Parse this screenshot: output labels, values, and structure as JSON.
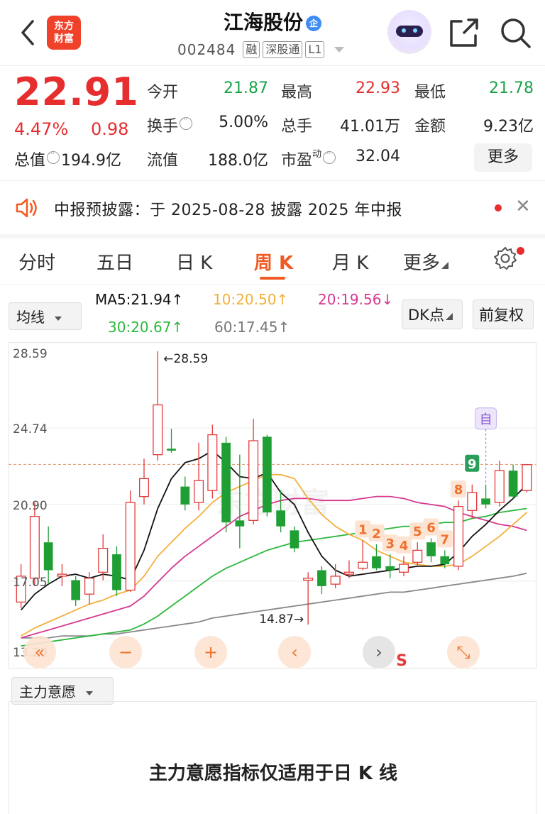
{
  "header": {
    "title": "江海股份",
    "title_badge": "企",
    "code": "002484",
    "tags": [
      "融",
      "深股通",
      "L1"
    ],
    "logo_line1": "东方",
    "logo_line2": "财富"
  },
  "quote": {
    "price": "22.91",
    "change_pct": "4.47%",
    "change": "0.98",
    "total_value_label": "总值",
    "total_value": "194.9亿",
    "fields": [
      {
        "label": "今开",
        "value": "21.87",
        "color": "green"
      },
      {
        "label": "最高",
        "value": "22.93",
        "color": "red"
      },
      {
        "label": "最低",
        "value": "21.78",
        "color": "green"
      },
      {
        "label": "换手",
        "value": "5.00%",
        "color": "black",
        "info": true
      },
      {
        "label": "总手",
        "value": "41.01万",
        "color": "black"
      },
      {
        "label": "金额",
        "value": "9.23亿",
        "color": "black"
      },
      {
        "label": "流值",
        "value": "188.0亿",
        "color": "black"
      },
      {
        "label": "市盈",
        "label_sup": "动",
        "value": "32.04",
        "color": "black",
        "info": true
      }
    ],
    "more_label": "更多"
  },
  "notice": {
    "text": "中报预披露：于 2025-08-28 披露 2025 年中报"
  },
  "tabs": [
    "分时",
    "五日",
    "日 K",
    "周 K",
    "月 K",
    "更多"
  ],
  "active_tab": "周 K",
  "indicator": {
    "select_label": "均线",
    "ma5": "MA5:21.94",
    "ma10": "10:20.50",
    "ma20": "20:19.56",
    "ma30": "30:20.67",
    "ma60": "60:17.45",
    "dk_label": "DK点",
    "fq_label": "前复权",
    "colors": {
      "ma5": "#111111",
      "ma10": "#f2b03c",
      "ma20": "#d6388f",
      "ma30": "#2db83d",
      "ma60": "#888888"
    }
  },
  "chart_data": {
    "type": "candlestick",
    "y_ticks": [
      "28.59",
      "24.74",
      "20.90",
      "17.05",
      "13.20"
    ],
    "ylim": [
      13.2,
      28.59
    ],
    "max_label": "←28.59",
    "min_label": "14.87→",
    "last_close": 22.91,
    "watermark": "东方财富",
    "candles": [
      {
        "o": 16.0,
        "c": 17.3,
        "h": 17.9,
        "l": 15.7
      },
      {
        "o": 17.2,
        "c": 20.3,
        "h": 21.0,
        "l": 16.8
      },
      {
        "o": 19.0,
        "c": 17.6,
        "h": 19.8,
        "l": 16.9
      },
      {
        "o": 17.3,
        "c": 17.4,
        "h": 17.9,
        "l": 16.8
      },
      {
        "o": 17.1,
        "c": 16.1,
        "h": 17.3,
        "l": 15.8
      },
      {
        "o": 16.4,
        "c": 17.2,
        "h": 17.5,
        "l": 15.9
      },
      {
        "o": 17.5,
        "c": 18.7,
        "h": 19.4,
        "l": 17.1
      },
      {
        "o": 18.4,
        "c": 16.6,
        "h": 18.8,
        "l": 16.3
      },
      {
        "o": 16.6,
        "c": 21.0,
        "h": 21.6,
        "l": 16.5
      },
      {
        "o": 21.3,
        "c": 22.2,
        "h": 23.2,
        "l": 20.9
      },
      {
        "o": 23.4,
        "c": 25.9,
        "h": 28.59,
        "l": 23.1
      },
      {
        "o": 23.7,
        "c": 23.6,
        "h": 24.7,
        "l": 23.5
      },
      {
        "o": 21.8,
        "c": 20.9,
        "h": 22.3,
        "l": 20.6
      },
      {
        "o": 21.0,
        "c": 22.1,
        "h": 24.0,
        "l": 20.6
      },
      {
        "o": 21.6,
        "c": 24.4,
        "h": 24.9,
        "l": 21.2
      },
      {
        "o": 24.0,
        "c": 20.0,
        "h": 24.3,
        "l": 19.5
      },
      {
        "o": 20.1,
        "c": 19.8,
        "h": 23.4,
        "l": 18.7
      },
      {
        "o": 20.1,
        "c": 24.1,
        "h": 25.2,
        "l": 19.9
      },
      {
        "o": 24.3,
        "c": 20.5,
        "h": 24.4,
        "l": 20.3
      },
      {
        "o": 20.6,
        "c": 19.8,
        "h": 21.6,
        "l": 19.5
      },
      {
        "o": 19.6,
        "c": 18.7,
        "h": 19.8,
        "l": 18.5
      },
      {
        "o": 17.1,
        "c": 17.2,
        "h": 17.5,
        "l": 14.87
      },
      {
        "o": 17.6,
        "c": 16.8,
        "h": 17.8,
        "l": 16.4
      },
      {
        "o": 16.9,
        "c": 17.3,
        "h": 17.9,
        "l": 16.7
      },
      {
        "o": 17.4,
        "c": 17.5,
        "h": 18.1,
        "l": 17.2
      },
      {
        "o": 17.7,
        "c": 18.0,
        "h": 19.1,
        "l": 17.6
      },
      {
        "o": 18.3,
        "c": 17.7,
        "h": 18.9,
        "l": 17.6
      },
      {
        "o": 17.8,
        "c": 17.6,
        "h": 18.4,
        "l": 17.2
      },
      {
        "o": 17.5,
        "c": 17.9,
        "h": 18.3,
        "l": 17.3
      },
      {
        "o": 18.0,
        "c": 18.6,
        "h": 19.0,
        "l": 17.8
      },
      {
        "o": 19.0,
        "c": 18.3,
        "h": 19.2,
        "l": 18.0
      },
      {
        "o": 18.3,
        "c": 17.9,
        "h": 18.6,
        "l": 17.7
      },
      {
        "o": 17.8,
        "c": 20.8,
        "h": 21.1,
        "l": 17.6
      },
      {
        "o": 20.6,
        "c": 21.5,
        "h": 21.9,
        "l": 20.2
      },
      {
        "o": 21.2,
        "c": 20.9,
        "h": 21.9,
        "l": 20.7
      },
      {
        "o": 21.0,
        "c": 22.6,
        "h": 23.1,
        "l": 20.8
      },
      {
        "o": 22.6,
        "c": 21.3,
        "h": 22.9,
        "l": 21.2
      },
      {
        "o": 21.6,
        "c": 22.9,
        "h": 22.93,
        "l": 21.5
      }
    ],
    "ma5_line": [
      15.6,
      16.4,
      16.9,
      17.3,
      17.4,
      17.2,
      17.4,
      17.3,
      17.1,
      18.6,
      20.7,
      22.2,
      23.0,
      23.2,
      23.6,
      23.0,
      22.3,
      22.2,
      22.5,
      21.5,
      20.9,
      19.5,
      18.3,
      17.6,
      17.3,
      17.4,
      17.5,
      17.6,
      17.7,
      17.8,
      17.8,
      17.9,
      18.5,
      19.3,
      19.9,
      20.6,
      21.2,
      21.9
    ],
    "ma10_line": [
      14.3,
      14.7,
      15.0,
      15.3,
      15.6,
      15.9,
      16.1,
      16.4,
      16.6,
      17.3,
      18.3,
      19.0,
      19.7,
      20.3,
      21.0,
      21.5,
      21.8,
      22.1,
      22.4,
      22.4,
      22.2,
      21.2,
      20.4,
      19.8,
      19.4,
      19.1,
      18.6,
      18.3,
      18.0,
      17.9,
      17.8,
      17.8,
      17.9,
      18.3,
      18.8,
      19.3,
      19.9,
      20.5
    ],
    "ma20_line": [
      14.2,
      14.4,
      14.6,
      14.8,
      15.0,
      15.2,
      15.4,
      15.6,
      15.8,
      16.3,
      17.0,
      17.7,
      18.3,
      18.8,
      19.3,
      19.8,
      20.3,
      20.6,
      20.9,
      21.1,
      21.2,
      21.2,
      21.1,
      21.1,
      21.1,
      21.2,
      21.3,
      21.3,
      21.2,
      21.0,
      20.9,
      20.8,
      20.5,
      20.3,
      20.1,
      19.9,
      19.8,
      19.6
    ],
    "ma30_line": [
      13.8,
      13.9,
      14.0,
      14.1,
      14.2,
      14.3,
      14.4,
      14.5,
      14.6,
      14.9,
      15.3,
      15.8,
      16.3,
      16.8,
      17.3,
      17.7,
      18.0,
      18.3,
      18.6,
      18.8,
      19.0,
      19.1,
      19.2,
      19.3,
      19.4,
      19.5,
      19.6,
      19.7,
      19.8,
      19.8,
      19.9,
      20.0,
      20.0,
      20.2,
      20.3,
      20.5,
      20.6,
      20.7
    ],
    "ma60_line": [
      14.2,
      14.2,
      14.2,
      14.3,
      14.3,
      14.3,
      14.4,
      14.4,
      14.5,
      14.6,
      14.7,
      14.8,
      14.9,
      15.0,
      15.2,
      15.3,
      15.4,
      15.5,
      15.6,
      15.7,
      15.8,
      15.9,
      16.0,
      16.1,
      16.2,
      16.3,
      16.4,
      16.5,
      16.5,
      16.6,
      16.7,
      16.8,
      16.9,
      17.0,
      17.1,
      17.2,
      17.3,
      17.45
    ],
    "markers": [
      {
        "label": "1",
        "i": 25
      },
      {
        "label": "2",
        "i": 26
      },
      {
        "label": "3",
        "i": 27
      },
      {
        "label": "4",
        "i": 28
      },
      {
        "label": "5",
        "i": 29
      },
      {
        "label": "6",
        "i": 30
      },
      {
        "label": "7",
        "i": 31
      },
      {
        "label": "8",
        "i": 32
      },
      {
        "label": "9",
        "i": 33
      },
      {
        "label": "自",
        "i": 34
      }
    ],
    "nav_buttons": [
      "«",
      "−",
      "+",
      "‹",
      "›",
      "⤡"
    ],
    "s_label": "S"
  },
  "bottom": {
    "select_label": "主力意愿",
    "message": "主力意愿指标仅适用于日 K 线"
  }
}
